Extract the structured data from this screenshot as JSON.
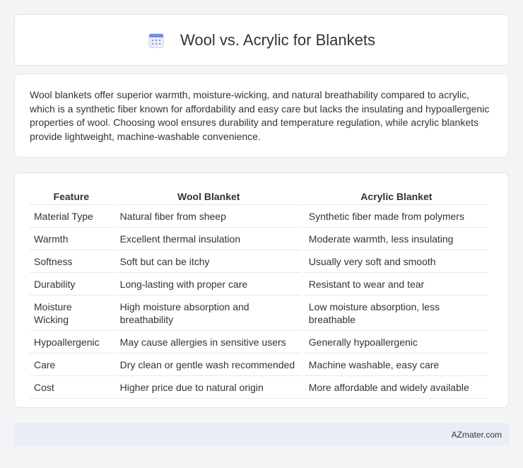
{
  "header": {
    "title": "Wool vs. Acrylic for Blankets",
    "icon": "calendar-icon"
  },
  "intro": {
    "text": "Wool blankets offer superior warmth, moisture-wicking, and natural breathability compared to acrylic, which is a synthetic fiber known for affordability and easy care but lacks the insulating and hypoallergenic properties of wool. Choosing wool ensures durability and temperature regulation, while acrylic blankets provide lightweight, machine-washable convenience."
  },
  "table": {
    "headers": [
      "Feature",
      "Wool Blanket",
      "Acrylic Blanket"
    ],
    "rows": [
      [
        "Material Type",
        "Natural fiber from sheep",
        "Synthetic fiber made from polymers"
      ],
      [
        "Warmth",
        "Excellent thermal insulation",
        "Moderate warmth, less insulating"
      ],
      [
        "Softness",
        "Soft but can be itchy",
        "Usually very soft and smooth"
      ],
      [
        "Durability",
        "Long-lasting with proper care",
        "Resistant to wear and tear"
      ],
      [
        "Moisture Wicking",
        "High moisture absorption and breathability",
        "Low moisture absorption, less breathable"
      ],
      [
        "Hypoallergenic",
        "May cause allergies in sensitive users",
        "Generally hypoallergenic"
      ],
      [
        "Care",
        "Dry clean or gentle wash recommended",
        "Machine washable, easy care"
      ],
      [
        "Cost",
        "Higher price due to natural origin",
        "More affordable and widely available"
      ]
    ]
  },
  "footer": {
    "text": "AZmater.com"
  }
}
